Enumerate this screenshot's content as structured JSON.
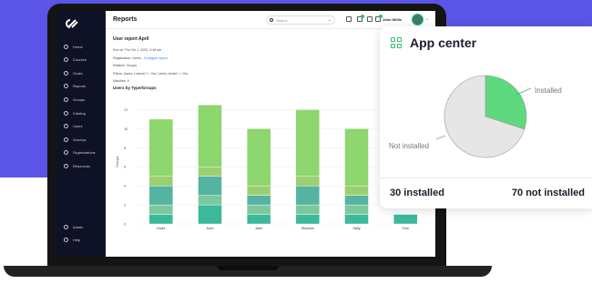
{
  "colors": {
    "accent": "#2cc26a",
    "background": "#5a55e6",
    "sidebar": "#0f1226"
  },
  "sidebar": {
    "logo_icon": "brand-logo-icon",
    "items": [
      {
        "label": "Home",
        "icon": "home-icon"
      },
      {
        "label": "Courses",
        "icon": "courses-icon"
      },
      {
        "label": "Goals",
        "icon": "goals-icon"
      },
      {
        "label": "Reports",
        "icon": "reports-icon"
      },
      {
        "label": "Groups",
        "icon": "groups-icon"
      },
      {
        "label": "Catalog",
        "icon": "catalog-icon"
      },
      {
        "label": "Users",
        "icon": "users-icon"
      },
      {
        "label": "Surveys",
        "icon": "surveys-icon"
      },
      {
        "label": "Organizations",
        "icon": "organizations-icon"
      },
      {
        "label": "Resources",
        "icon": "resources-icon"
      }
    ],
    "bottom_items": [
      {
        "label": "Admin",
        "icon": "admin-icon"
      },
      {
        "label": "Help",
        "icon": "help-icon"
      }
    ]
  },
  "header": {
    "title": "Reports",
    "search_placeholder": "Search",
    "user_name": "John Willis"
  },
  "report": {
    "title": "User report April",
    "run_at": "Run at: Thu Oct 1, 2020, 3:48 am",
    "registrations_prefix": "Registration: Users - ",
    "configure_link": "Configure report",
    "related": "Related: Groups",
    "filters": "Filters: Users: Learner? = Yes, Users: Active? = Yes",
    "matches": "Matches: 9",
    "chart_title": "Users by Type/Groups"
  },
  "chart_data": {
    "type": "bar",
    "stacked": true,
    "categories": [
      "Dodd",
      "John",
      "Jane",
      "Stephen",
      "Sally",
      "Tom"
    ],
    "ylabel": "Groups",
    "yticks": [
      0,
      2,
      4,
      6,
      8,
      10,
      12
    ],
    "ylim": [
      0,
      13
    ],
    "segment_colors": [
      "#3cb89a",
      "#7cc89c",
      "#55b3a2",
      "#9ccf72",
      "#8ed66e"
    ],
    "series": [
      {
        "values": [
          1,
          2,
          1,
          1,
          1,
          1
        ]
      },
      {
        "values": [
          1,
          1,
          1,
          1,
          1,
          0
        ]
      },
      {
        "values": [
          2,
          2,
          1,
          2,
          1,
          0
        ]
      },
      {
        "values": [
          1,
          1,
          1,
          1,
          1,
          0
        ]
      },
      {
        "values": [
          6,
          6.5,
          6,
          7,
          6,
          0
        ]
      }
    ]
  },
  "app_center": {
    "title": "App center",
    "icon": "apps-icon",
    "installed_label": "Installed",
    "not_installed_label": "Not installed",
    "installed_count": "30 installed",
    "not_installed_count": "70 not installed",
    "chart_data": {
      "type": "pie",
      "slices": [
        {
          "name": "Installed",
          "value": 30,
          "color": "#5fd97f"
        },
        {
          "name": "Not installed",
          "value": 70,
          "color": "#e6e6e6"
        }
      ]
    }
  }
}
